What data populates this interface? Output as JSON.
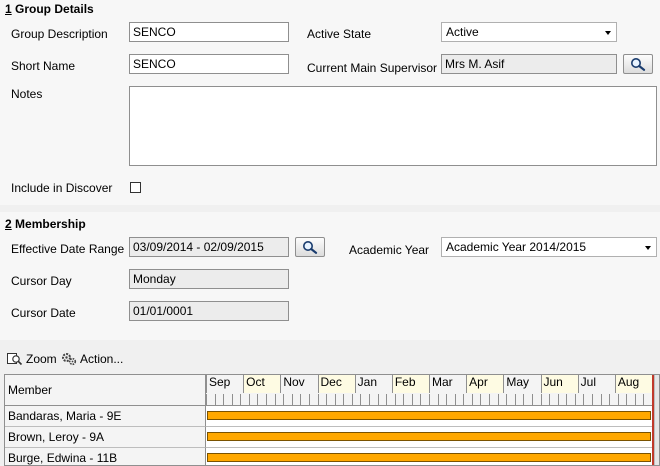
{
  "group_details": {
    "number": "1",
    "title": " Group Details",
    "description_label": "Group Description",
    "description_value": "SENCO",
    "short_name_label": "Short Name",
    "short_name_value": "SENCO",
    "notes_label": "Notes",
    "notes_value": "",
    "include_label": "Include in Discover",
    "include_checked": false,
    "active_state_label": "Active State",
    "active_state_value": "Active",
    "supervisor_label": "Current Main Supervisor",
    "supervisor_value": "Mrs M. Asif"
  },
  "membership": {
    "number": "2",
    "title": " Membership",
    "date_range_label": "Effective Date Range",
    "date_range_value": "03/09/2014 - 02/09/2015",
    "academic_year_label": "Academic Year",
    "academic_year_value": "Academic Year 2014/2015",
    "cursor_day_label": "Cursor Day",
    "cursor_day_value": "Monday",
    "cursor_date_label": "Cursor Date",
    "cursor_date_value": "01/01/0001"
  },
  "toolbar": {
    "zoom_label": "Zoom",
    "action_label": "Action..."
  },
  "grid": {
    "member_header": "Member",
    "months": [
      "Sep",
      "Oct",
      "Nov",
      "Dec",
      "Jan",
      "Feb",
      "Mar",
      "Apr",
      "May",
      "Jun",
      "Jul",
      "Aug"
    ],
    "members": [
      {
        "name": "Bandaras, Maria - 9E"
      },
      {
        "name": "Brown, Leroy - 9A"
      },
      {
        "name": "Burge, Edwina - 11B"
      }
    ]
  },
  "colors": {
    "bar": "#ffa800",
    "month_alt": "#fefbe3",
    "panel": "#f7f7f7"
  }
}
